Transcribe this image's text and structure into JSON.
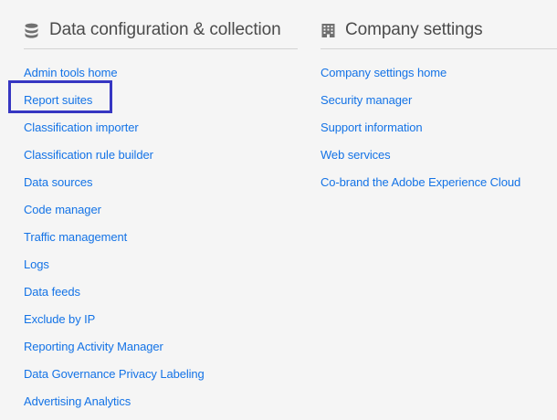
{
  "data_config": {
    "title": "Data configuration & collection",
    "icon": "database-icon",
    "links": [
      "Admin tools home",
      "Report suites",
      "Classification importer",
      "Classification rule builder",
      "Data sources",
      "Code manager",
      "Traffic management",
      "Logs",
      "Data feeds",
      "Exclude by IP",
      "Reporting Activity Manager",
      "Data Governance Privacy Labeling",
      "Advertising Analytics"
    ]
  },
  "company_settings": {
    "title": "Company settings",
    "icon": "building-icon",
    "links": [
      "Company settings home",
      "Security manager",
      "Support information",
      "Web services",
      "Co-brand the Adobe Experience Cloud"
    ]
  },
  "colors": {
    "link": "#1473e6",
    "heading": "#4b4b4b",
    "highlight": "#3636c2",
    "background": "#f5f5f5"
  }
}
